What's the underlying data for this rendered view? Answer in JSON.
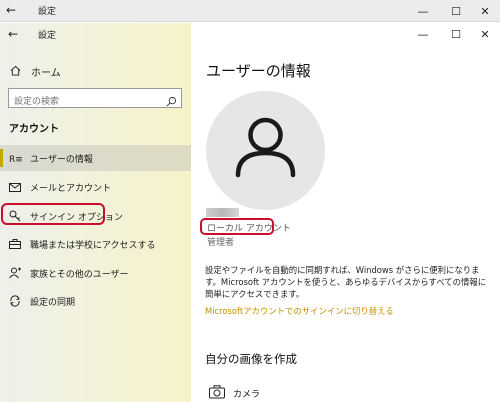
{
  "outer_window": {
    "title": "設定",
    "back_glyph": "←",
    "minimize_glyph": "—",
    "maximize_glyph": "☐",
    "close_glyph": "✕"
  },
  "window": {
    "title": "設定",
    "back_glyph": "←",
    "minimize_glyph": "—",
    "maximize_glyph": "☐",
    "close_glyph": "✕"
  },
  "sidebar": {
    "home_label": "ホーム",
    "search_placeholder": "設定の検索",
    "section_label": "アカウント",
    "items": [
      {
        "label": "ユーザーの情報",
        "icon": "user-info-icon"
      },
      {
        "label": "メールとアカウント",
        "icon": "mail-icon"
      },
      {
        "label": "サインイン オプション",
        "icon": "key-icon"
      },
      {
        "label": "職場または学校にアクセスする",
        "icon": "briefcase-icon"
      },
      {
        "label": "家族とその他のユーザー",
        "icon": "person-add-icon"
      },
      {
        "label": "設定の同期",
        "icon": "sync-icon"
      }
    ],
    "active_index": 0,
    "accent_color": "#c8a800"
  },
  "main": {
    "title": "ユーザーの情報",
    "account_type": "ローカル アカウント",
    "account_role": "管理者",
    "description": "設定やファイルを自動的に同期すれば、Windows がさらに便利になります。Microsoft アカウントを使うと、あらゆるデバイスからすべての情報に簡単にアクセスできます。",
    "link_text": "Microsoftアカウントでのサインインに切り替える",
    "link_color": "#c89000",
    "section2_title": "自分の画像を作成",
    "camera_label": "カメラ"
  },
  "highlight_color": "#c8102e"
}
